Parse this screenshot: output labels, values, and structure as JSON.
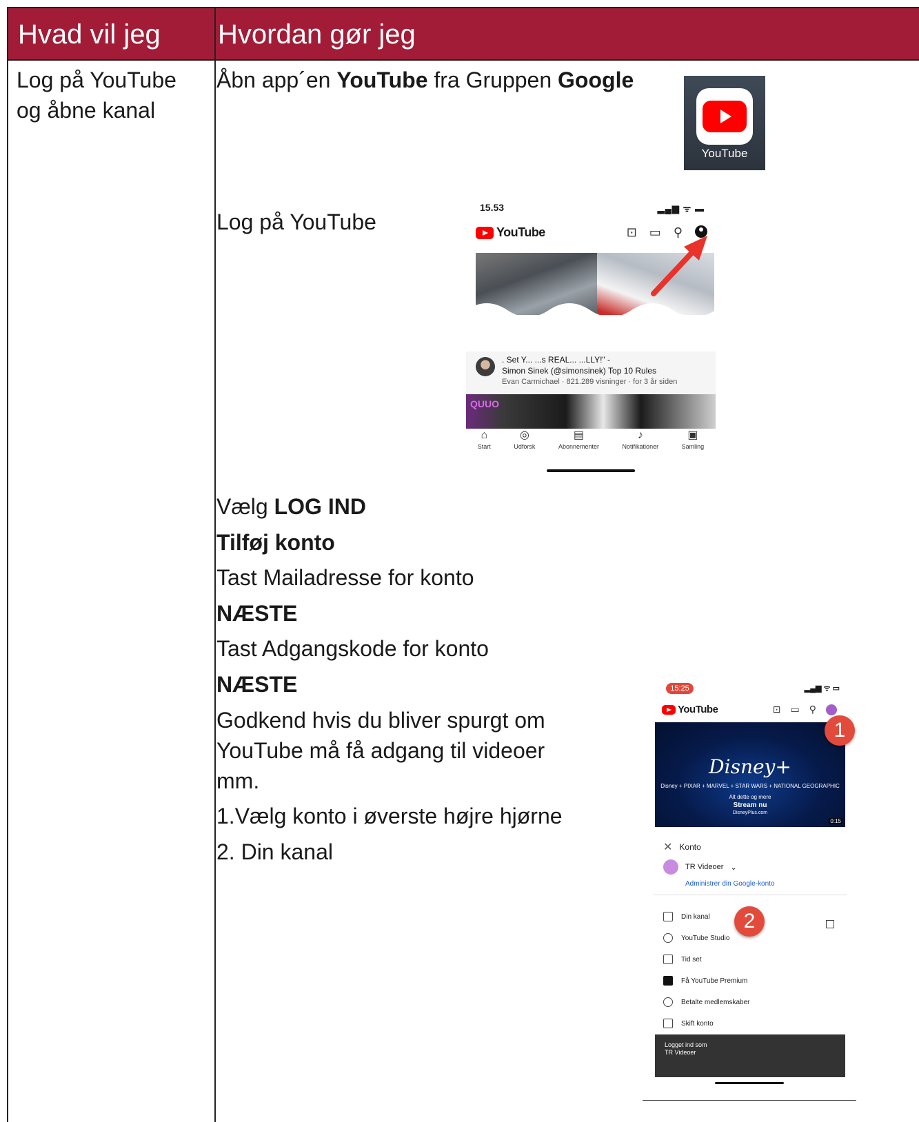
{
  "header": {
    "col1": "Hvad vil jeg",
    "col2": "Hvordan gør jeg"
  },
  "task": {
    "line1": "Log på YouTube",
    "line2": "og åbne kanal"
  },
  "step_open": {
    "prefix": "Åbn app´en ",
    "app": "YouTube",
    "middle": " fra Gruppen ",
    "group": "Google"
  },
  "app_icon": {
    "label": "YouTube",
    "icon": "youtube-app-icon"
  },
  "step_login": "Log på YouTube",
  "phone1": {
    "time": "15.53",
    "status": "▂▄▆ ᯤ ▬",
    "logo": "YouTube",
    "video_title_line1": ". Set Y...  ...s REAL...  ...LLY!\" -",
    "video_title_line2": "Simon Sinek (@simonsinek) Top 10 Rules",
    "video_meta": "Evan Carmichael · 821.289 visninger · for 3 år siden",
    "thumb_tag": "QUUO",
    "nav": [
      "Start",
      "Udforsk",
      "Abonnementer",
      "Notifikationer",
      "Samling"
    ]
  },
  "steps": {
    "s1_prefix": "Vælg ",
    "s1_bold": "LOG IND",
    "s2": "Tilføj konto",
    "s3": "Tast Mailadresse for konto",
    "s4": "NÆSTE",
    "s5": "Tast Adgangskode for konto",
    "s6": "NÆSTE",
    "s7_line1": "Godkend hvis du bliver spurgt om",
    "s7_line2": "YouTube må få adgang til videoer",
    "s7_line3": "mm.",
    "s8": "1.Vælg konto i øverste højre hjørne",
    "s9": "2. Din kanal"
  },
  "phone2": {
    "time": "15:25",
    "status": "▂▄▆ ᯤ ▭",
    "logo": "YouTube",
    "banner_brand": "Disney+",
    "banner_partners": "Disney + PIXAR + MARVEL + STAR WARS + NATIONAL GEOGRAPHIC",
    "banner_line1": "Alt dette og mere",
    "banner_line2": "Stream nu",
    "banner_line3": "DisneyPlus.com",
    "banner_duration": "0:15",
    "menu_title": "Konto",
    "account_name": "TR Videoer",
    "manage": "Administrer din Google-konto",
    "items": [
      "Din kanal",
      "YouTube Studio",
      "Tid set",
      "Få YouTube Premium",
      "Betalte medlemskaber",
      "Skift konto"
    ],
    "toast_line1": "Logget ind som",
    "toast_line2": "TR Videoer"
  },
  "badges": [
    "1",
    "2"
  ],
  "colors": {
    "header_bg": "#a31c37",
    "badge": "#e24a3b",
    "youtube_red": "#ff0000"
  }
}
